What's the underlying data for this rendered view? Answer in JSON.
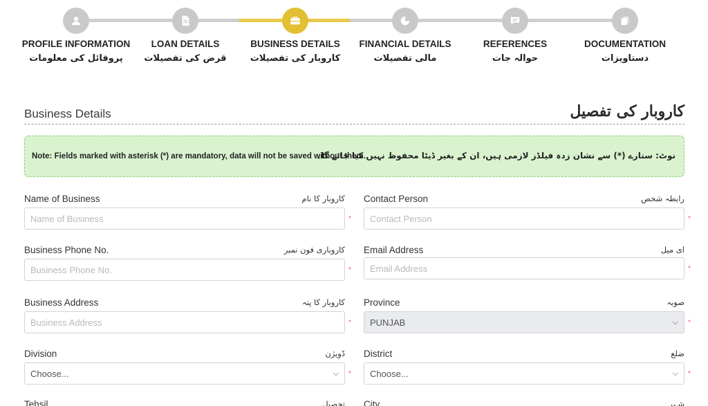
{
  "stepper": {
    "steps": [
      {
        "en": "PROFILE INFORMATION",
        "ur": "پروفائل کی معلومات",
        "icon": "user-icon",
        "active": false
      },
      {
        "en": "LOAN DETAILS",
        "ur": "قرض کی تفصیلات",
        "icon": "document-icon",
        "active": false
      },
      {
        "en": "BUSINESS DETAILS",
        "ur": "کاروبار کی تفصیلات",
        "icon": "briefcase-icon",
        "active": true
      },
      {
        "en": "FINANCIAL DETAILS",
        "ur": "مالی تفصیلات",
        "icon": "chart-pie-icon",
        "active": false
      },
      {
        "en": "REFERENCES",
        "ur": "حوالہ جات",
        "icon": "chat-icon",
        "active": false
      },
      {
        "en": "DOCUMENTATION",
        "ur": "دستاویزات",
        "icon": "files-icon",
        "active": false
      }
    ],
    "active_color": "#e2bf33",
    "inactive_color": "#c9c9c9"
  },
  "section": {
    "title": "Business Details",
    "title_ur": "کاروبار کی تفصیل"
  },
  "note": {
    "en": "Note: Fields marked with asterisk (*) are mandatory, data will not be saved without them.",
    "ur": "نوٹ: ستارے (*) سے نشان زدہ فیلڈز لازمی ہیں، ان کے بغیر ڈیٹا محفوظ نہیں کیا جائے گا۔"
  },
  "form": {
    "name_of_business": {
      "label": "Name of Business",
      "label_ur": "کاروبار کا نام",
      "placeholder": "Name of Business",
      "required": "*"
    },
    "contact_person": {
      "label": "Contact Person",
      "label_ur": "رابطہ شخص",
      "placeholder": "Contact Person",
      "required": "*"
    },
    "business_phone": {
      "label": "Business Phone No.",
      "label_ur": "کاروباری فون نمبر",
      "placeholder": "Business Phone No.",
      "required": "*"
    },
    "email": {
      "label": "Email Address",
      "label_ur": "ای میل",
      "placeholder": "Email Address",
      "required": "*"
    },
    "business_address": {
      "label": "Business Address",
      "label_ur": "کاروبار کا پتہ",
      "placeholder": "Business Address",
      "required": "*"
    },
    "province": {
      "label": "Province",
      "label_ur": "صوبہ",
      "value": "PUNJAB",
      "required": "*"
    },
    "division": {
      "label": "Division",
      "label_ur": "ڈویژن",
      "value": "Choose...",
      "required": "*"
    },
    "district": {
      "label": "District",
      "label_ur": "ضلع",
      "value": "Choose...",
      "required": "*"
    },
    "tehsil": {
      "label": "Tehsil",
      "label_ur": "تحصیل"
    },
    "city": {
      "label": "City",
      "label_ur": "شہر"
    }
  }
}
